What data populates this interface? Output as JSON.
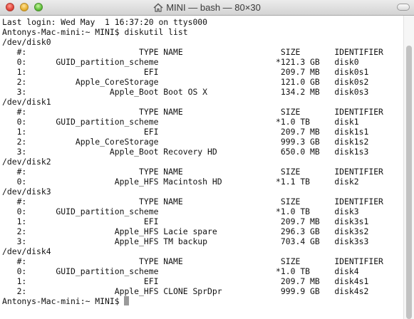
{
  "window": {
    "title": "MINI — bash — 80×30",
    "title_icon": "home-icon",
    "traffic_lights": [
      "close",
      "minimize",
      "zoom"
    ]
  },
  "terminal": {
    "lines": [
      "Last login: Wed May  1 16:37:20 on ttys000",
      "Antonys-Mac-mini:~ MINI$ diskutil list",
      "/dev/disk0",
      "   #:                       TYPE NAME                    SIZE       IDENTIFIER",
      "   0:      GUID_partition_scheme                        *121.3 GB   disk0",
      "   1:                        EFI                         209.7 MB   disk0s1",
      "   2:          Apple_CoreStorage                         121.0 GB   disk0s2",
      "   3:                 Apple_Boot Boot OS X               134.2 MB   disk0s3",
      "/dev/disk1",
      "   #:                       TYPE NAME                    SIZE       IDENTIFIER",
      "   0:      GUID_partition_scheme                        *1.0 TB     disk1",
      "   1:                        EFI                         209.7 MB   disk1s1",
      "   2:          Apple_CoreStorage                         999.3 GB   disk1s2",
      "   3:                 Apple_Boot Recovery HD             650.0 MB   disk1s3",
      "/dev/disk2",
      "   #:                       TYPE NAME                    SIZE       IDENTIFIER",
      "   0:                  Apple_HFS Macintosh HD           *1.1 TB     disk2",
      "/dev/disk3",
      "   #:                       TYPE NAME                    SIZE       IDENTIFIER",
      "   0:      GUID_partition_scheme                        *1.0 TB     disk3",
      "   1:                        EFI                         209.7 MB   disk3s1",
      "   2:                  Apple_HFS Lacie spare             296.3 GB   disk3s2",
      "   3:                  Apple_HFS TM backup               703.4 GB   disk3s3",
      "/dev/disk4",
      "   #:                       TYPE NAME                    SIZE       IDENTIFIER",
      "   0:      GUID_partition_scheme                        *1.0 TB     disk4",
      "   1:                        EFI                         209.7 MB   disk4s1",
      "   2:                  Apple_HFS CLONE SprDpr            999.9 GB   disk4s2"
    ],
    "prompt": "Antonys-Mac-mini:~ MINI$ "
  }
}
